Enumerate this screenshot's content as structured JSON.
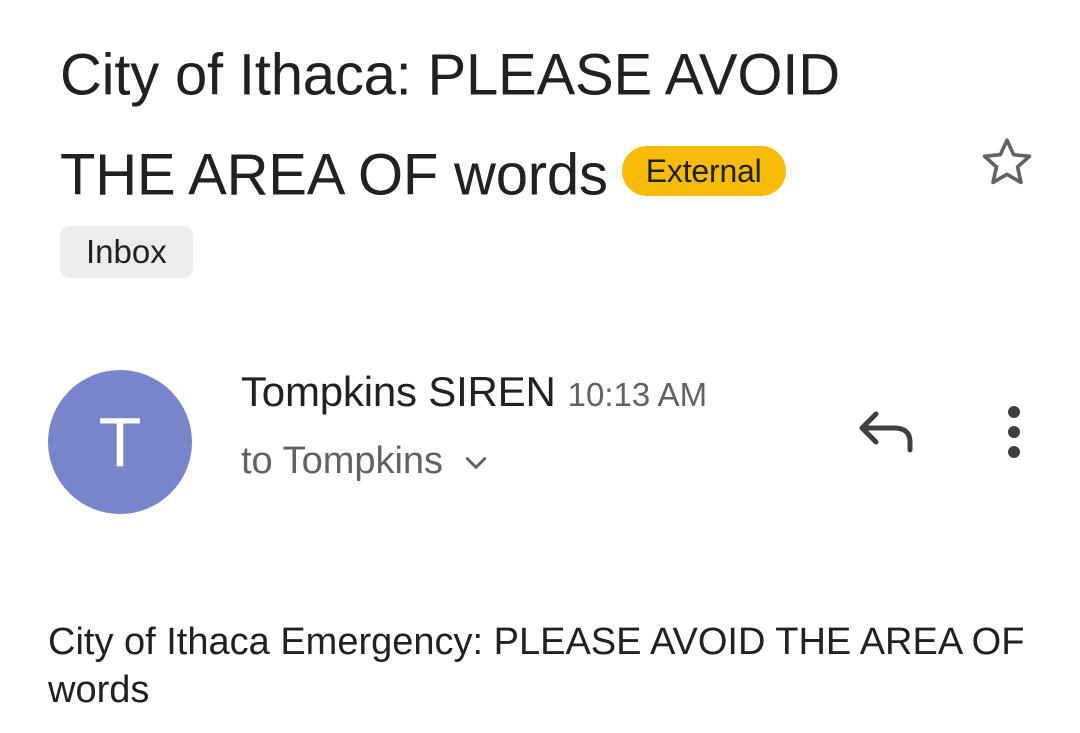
{
  "email": {
    "subject": "City of Ithaca: PLEASE AVOID THE AREA OF  words",
    "external_badge": "External",
    "label_chip": "Inbox",
    "starred": false
  },
  "message": {
    "avatar_letter": "T",
    "avatar_color": "#7885ca",
    "sender": "Tompkins SIREN",
    "time": "10:13 AM",
    "recipient": "to Tompkins",
    "body": "City of Ithaca Emergency: PLEASE AVOID THE AREA OF words"
  },
  "icons": {
    "star": "star-outline-icon",
    "chevron": "chevron-down-icon",
    "reply": "reply-icon",
    "more": "more-vert-icon"
  },
  "colors": {
    "external_badge": "#f8bb07",
    "chip_bg": "#ececec",
    "secondary_text": "#5f6368"
  }
}
